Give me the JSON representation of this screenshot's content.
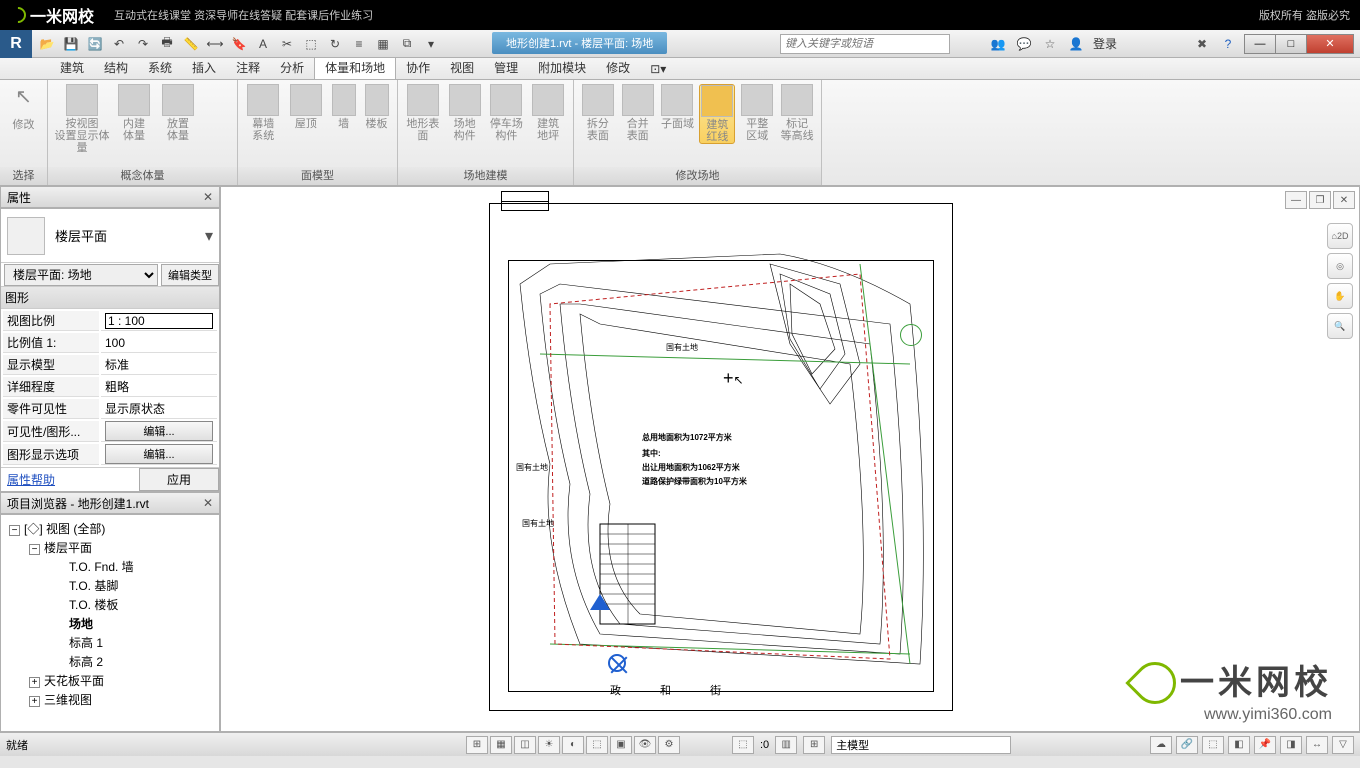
{
  "brand": {
    "name": "一米网校",
    "tagline": "互动式在线课堂 资深导师在线答疑 配套课后作业练习",
    "copyright": "版权所有 盗版必究"
  },
  "title_bar": {
    "doc_title": "地形创建1.rvt - 楼层平面: 场地",
    "search_placeholder": "键入关键字或短语",
    "login": "登录"
  },
  "menu": {
    "tabs": [
      "建筑",
      "结构",
      "系统",
      "插入",
      "注释",
      "分析",
      "体量和场地",
      "协作",
      "视图",
      "管理",
      "附加模块",
      "修改"
    ],
    "active": "体量和场地"
  },
  "ribbon": {
    "select_label": "选择",
    "groups": [
      {
        "label": "概念体量",
        "buttons": [
          {
            "l1": "修改",
            "l2": ""
          },
          {
            "l1": "按视图",
            "l2": "设置显示体量"
          },
          {
            "l1": "内建",
            "l2": "体量"
          },
          {
            "l1": "放置",
            "l2": "体量"
          }
        ]
      },
      {
        "label": "面模型",
        "buttons": [
          {
            "l1": "幕墙",
            "l2": "系统"
          },
          {
            "l1": "屋顶",
            "l2": ""
          },
          {
            "l1": "墙",
            "l2": ""
          },
          {
            "l1": "楼板",
            "l2": ""
          }
        ]
      },
      {
        "label": "场地建模",
        "buttons": [
          {
            "l1": "地形表面",
            "l2": ""
          },
          {
            "l1": "场地",
            "l2": "构件"
          },
          {
            "l1": "停车场",
            "l2": "构件"
          },
          {
            "l1": "建筑",
            "l2": "地坪"
          }
        ]
      },
      {
        "label": "修改场地",
        "buttons": [
          {
            "l1": "拆分",
            "l2": "表面"
          },
          {
            "l1": "合并",
            "l2": "表面"
          },
          {
            "l1": "子面域",
            "l2": ""
          },
          {
            "l1": "建筑",
            "l2": "红线",
            "hl": true
          },
          {
            "l1": "平整",
            "l2": "区域"
          },
          {
            "l1": "标记",
            "l2": "等高线"
          }
        ]
      }
    ],
    "select_btn": "修改"
  },
  "properties": {
    "title": "属性",
    "type_name": "楼层平面",
    "instance": "楼层平面: 场地",
    "edit_type": "编辑类型",
    "group": "图形",
    "rows": [
      {
        "k": "视图比例",
        "v": "1 : 100"
      },
      {
        "k": "比例值 1:",
        "v": "100"
      },
      {
        "k": "显示模型",
        "v": "标准"
      },
      {
        "k": "详细程度",
        "v": "粗略"
      },
      {
        "k": "零件可见性",
        "v": "显示原状态"
      },
      {
        "k": "可见性/图形...",
        "btn": "编辑..."
      },
      {
        "k": "图形显示选项",
        "btn": "编辑..."
      }
    ],
    "help": "属性帮助",
    "apply": "应用"
  },
  "browser": {
    "title": "项目浏览器 - 地形创建1.rvt",
    "root": "视图 (全部)",
    "floor_plans": "楼层平面",
    "items": [
      "T.O. Fnd. 墙",
      "T.O. 基脚",
      "T.O. 楼板",
      "场地",
      "标高 1",
      "标高 2"
    ],
    "active_item": "场地",
    "ceiling": "天花板平面",
    "threeD": "三维视图"
  },
  "canvas": {
    "text_guyou1": "国有土地",
    "text_guyou2": "国有土地",
    "text_guyou3": "国有土地",
    "center1": "总用地面积为1072平方米",
    "center2": "其中:",
    "center3": "出让用地面积为1062平方米",
    "center4": "道路保护绿带面积为10平方米",
    "bottom_text": "政    和    街"
  },
  "status": {
    "ready": "就绪",
    "main_model": "主模型",
    "sel_count": ":0"
  },
  "watermark": {
    "text": "一米网校",
    "url": "www.yimi360.com"
  }
}
